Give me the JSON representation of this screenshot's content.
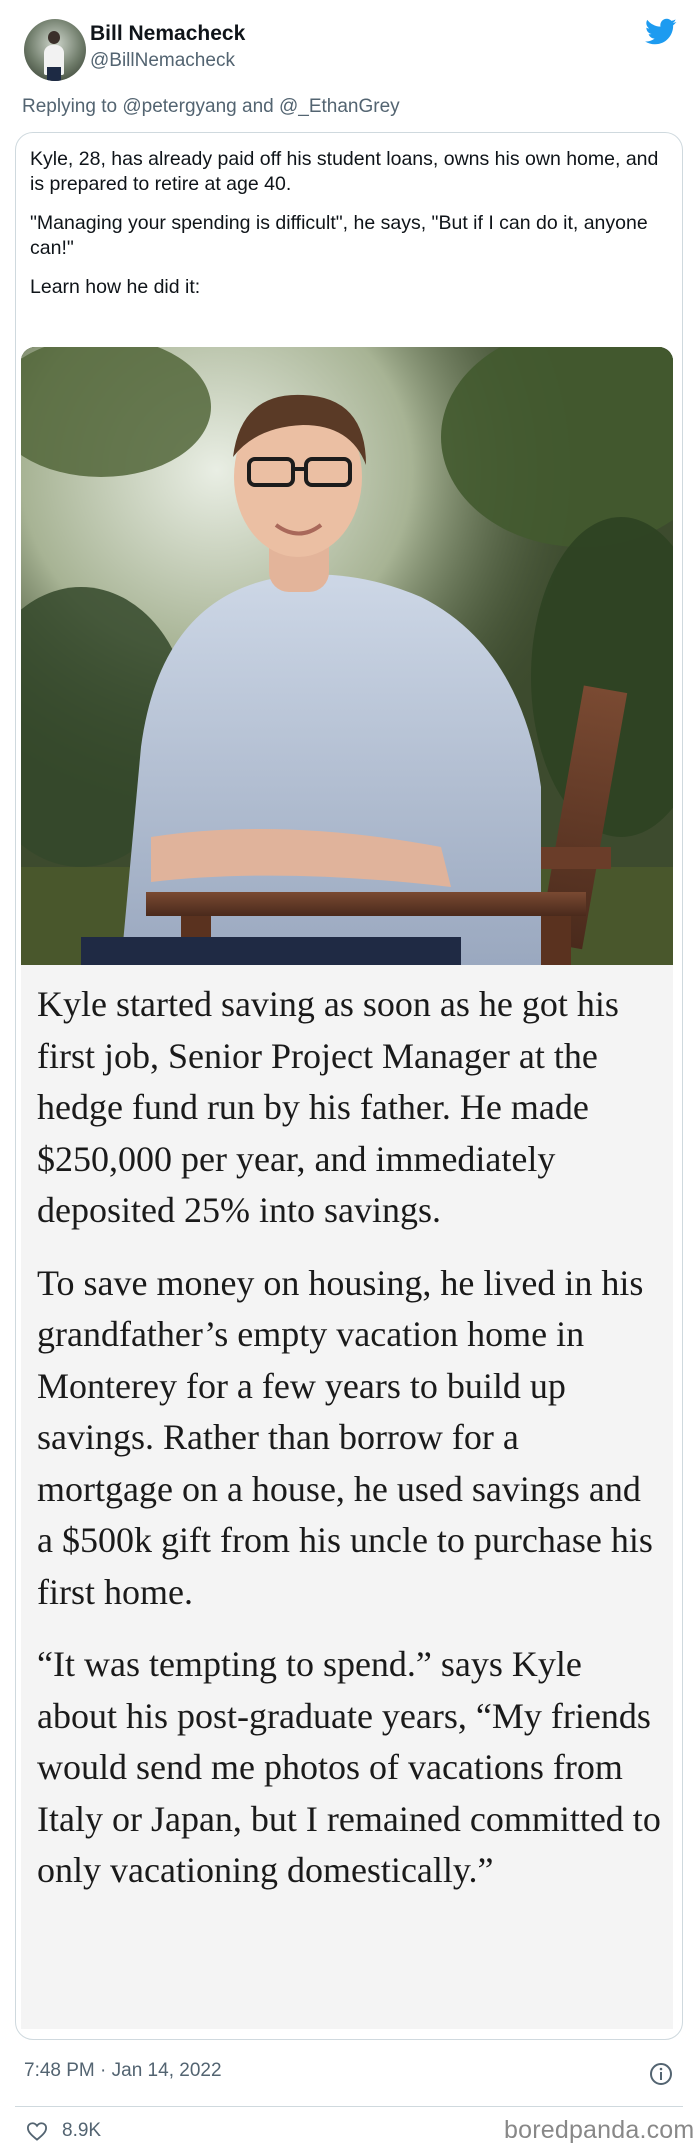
{
  "header": {
    "display_name": "Bill Nemacheck",
    "handle": "@BillNemacheck",
    "reply_prefix": "Replying to ",
    "reply_user_1": "@petergyang",
    "reply_and": " and ",
    "reply_user_2": "@_EthanGrey",
    "avatar_icon": "avatar",
    "logo_icon": "twitter-bird-icon",
    "accent_color": "#1d9bf0"
  },
  "quote": {
    "intro": [
      "Kyle, 28, has already paid off his student loans, owns his own home, and is prepared to retire at age 40.",
      "\"Managing your spending is difficult\", he says, \"But if I can do it, anyone can!\"",
      "Learn how he did it:"
    ],
    "article": [
      "Kyle started saving as soon as he got his first job, Senior Project Manager at the hedge fund run by his father. He made $250,000 per year, and immediately deposited 25% into savings.",
      "To save money on housing, he lived in his grandfather’s empty vacation home in Monterey for a few years to build up savings. Rather than borrow for a mortgage on a house, he used savings and a $500k gift from his uncle to purchase his first home.",
      "“It was tempting to spend.” says Kyle about his post-graduate years, “My friends would send me photos of vacations from Italy or Japan, but I remained committed to only vacationing domestically.”"
    ]
  },
  "footer": {
    "timestamp": "7:48 PM · Jan 14, 2022",
    "likes": "8.9K",
    "watermark": "boredpanda.com",
    "info_icon": "info-icon",
    "like_icon": "heart-icon"
  }
}
